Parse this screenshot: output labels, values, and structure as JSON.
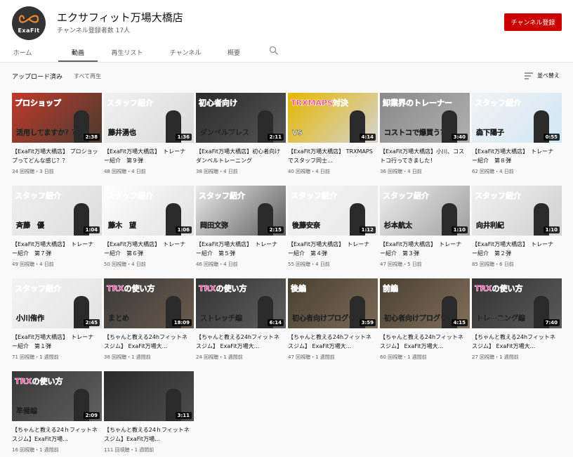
{
  "channel": {
    "name": "エクサフィット万場大橋店",
    "subscribers": "チャンネル登録者数 17人",
    "avatar_text": "ExaFit",
    "subscribe_label": "チャンネル登録"
  },
  "tabs": [
    {
      "label": "ホーム",
      "active": false
    },
    {
      "label": "動画",
      "active": true
    },
    {
      "label": "再生リスト",
      "active": false
    },
    {
      "label": "チャンネル",
      "active": false
    },
    {
      "label": "概要",
      "active": false
    }
  ],
  "search_icon": "search-icon",
  "filter": {
    "label": "アップロード済み",
    "all_label": "すべて再生"
  },
  "sort": {
    "label": "並べ替え",
    "icon": "sort-icon"
  },
  "colors": {
    "accent": "#cc0000",
    "thumb_pink": "#ff2d96"
  },
  "videos": [
    {
      "title": "【ExaFit万場大橋店】 プロショップってどんな感じ？？",
      "meta": "34 回視聴・3 日前",
      "duration": "2:38",
      "thumb_title": "プロショップ",
      "thumb_sub": "活用してますか？？",
      "palette": [
        "#c0392b",
        "#4a3b2f"
      ]
    },
    {
      "title": "【ExaFit万場大橋店】　トレーナー紹介　第９弾",
      "meta": "48 回視聴・4 日前",
      "duration": "1:36",
      "thumb_title": "スタッフ紹介",
      "thumb_sub": "藤井湧也",
      "palette": [
        "#f2f2f2",
        "#d9d9d9"
      ]
    },
    {
      "title": "【ExaFit万場大橋店】初心者向けダンベルトレーニング",
      "meta": "38 回視聴・4 日前",
      "duration": "2:11",
      "thumb_title": "初心者向け",
      "thumb_sub": "ダンベルプレス",
      "palette": [
        "#2b2b2b",
        "#555555"
      ]
    },
    {
      "title": "【ExaFit万場大橋店】 TRXMAPSでスタッフ同士...",
      "meta": "40 回視聴・4 日前",
      "duration": "4:14",
      "thumb_title": "TRXMAPS対決",
      "thumb_sub": "VS",
      "palette": [
        "#e6b800",
        "#d4d4d4"
      ]
    },
    {
      "title": "【ExaFit万場大橋店】小川、コストコ行ってきました！",
      "meta": "36 回視聴・4 日前",
      "duration": "3:40",
      "thumb_title": "卸業界のトレーナー",
      "thumb_sub": "コストコで爆買う？",
      "palette": [
        "#8a8a8a",
        "#b0b0b0"
      ]
    },
    {
      "title": "【ExaFit万場大橋店】　トレーナー紹介　第８弾",
      "meta": "62 回視聴・4 日前",
      "duration": "0:55",
      "thumb_title": "スタッフ紹介",
      "thumb_sub": "森下陽子",
      "palette": [
        "#f3f3f3",
        "#cfe6f5"
      ]
    },
    {
      "title": "【ExaFit万場大橋店】　トレーナー紹介　第７弾",
      "meta": "49 回視聴・4 日前",
      "duration": "1:04",
      "thumb_title": "スタッフ紹介",
      "thumb_sub": "斉藤　優",
      "palette": [
        "#f0f0f0",
        "#dcdcdc"
      ]
    },
    {
      "title": "【ExaFit万場大橋店】　トレーナー紹介　第６弾",
      "meta": "50 回視聴・4 日前",
      "duration": "1:06",
      "thumb_title": "スタッフ紹介",
      "thumb_sub": "藤木　望",
      "palette": [
        "#ffffff",
        "#e0e0e0"
      ]
    },
    {
      "title": "【ExaFit万場大橋店】　トレーナー紹介　第５弾",
      "meta": "46 回視聴・4 日前",
      "duration": "2:15",
      "thumb_title": "スタッフ紹介",
      "thumb_sub": "岡田文弥",
      "palette": [
        "#ececec",
        "#5c5c5c"
      ]
    },
    {
      "title": "【ExaFit万場大橋店】　トレーナー紹介　第４弾",
      "meta": "55 回視聴・4 日前",
      "duration": "1:12",
      "thumb_title": "スタッフ紹介",
      "thumb_sub": "後藤安奈",
      "palette": [
        "#f5f5f5",
        "#e8e8e8"
      ]
    },
    {
      "title": "【ExaFit万場大橋店】　トレーナー紹介　第３弾",
      "meta": "47 回視聴・5 日前",
      "duration": "1:10",
      "thumb_title": "スタッフ紹介",
      "thumb_sub": "杉本航太",
      "palette": [
        "#f0f0f0",
        "#9e9e9e"
      ]
    },
    {
      "title": "【ExaFit万場大橋店】　トレーナー紹介　第２弾",
      "meta": "85 回視聴・6 日前",
      "duration": "1:10",
      "thumb_title": "スタッフ紹介",
      "thumb_sub": "向井利紀",
      "palette": [
        "#f2f2f2",
        "#d0d0d0"
      ]
    },
    {
      "title": "【ExaFit万場大橋店】　トレーナー紹介　第１弾",
      "meta": "71 回視聴・1 週間前",
      "duration": "2:45",
      "thumb_title": "スタッフ紹介",
      "thumb_sub": "小川侑作",
      "palette": [
        "#f4f4f4",
        "#e2e2e2"
      ]
    },
    {
      "title": "【ちゃんと教える24hフィットネスジム】 ExaFit万場大...",
      "meta": "38 回視聴・1 週間前",
      "duration": "18:09",
      "thumb_title": "TRXの使い方",
      "thumb_sub": "まとめ",
      "palette": [
        "#3a3a3a",
        "#6b5b4b"
      ]
    },
    {
      "title": "【ちゃんと教える24hフィットネスジム】 ExaFit万場大...",
      "meta": "24 回視聴・1 週間前",
      "duration": "6:14",
      "thumb_title": "TRXの使い方",
      "thumb_sub": "ストレッチ編",
      "palette": [
        "#343434",
        "#5e5e5e"
      ]
    },
    {
      "title": "【ちゃんと教える24hフィットネスジム】 ExaFit万場大...",
      "meta": "47 回視聴・1 週間前",
      "duration": "3:59",
      "thumb_title": "後編",
      "thumb_sub": "初心者向けプログラム",
      "palette": [
        "#4a4030",
        "#7a6a55"
      ]
    },
    {
      "title": "【ちゃんと教える24hフィットネスジム】 ExaFit万場大...",
      "meta": "60 回視聴・1 週間前",
      "duration": "4:15",
      "thumb_title": "前編",
      "thumb_sub": "初心者向けプログラム",
      "palette": [
        "#4a4030",
        "#806f5a"
      ]
    },
    {
      "title": "【ちゃんと教える24hフィットネスジム】 ExaFit万場大...",
      "meta": "27 回視聴・1 週間前",
      "duration": "7:40",
      "thumb_title": "TRXの使い方",
      "thumb_sub": "トレーニング編",
      "palette": [
        "#333333",
        "#5a5a5a"
      ]
    },
    {
      "title": "【ちゃんと教える24ｈフィットネスジム】ExaFit万場...",
      "meta": "16 回視聴・1 週間前",
      "duration": "2:09",
      "thumb_title": "TRXの使い方",
      "thumb_sub": "準備編",
      "palette": [
        "#383838",
        "#606060"
      ]
    },
    {
      "title": "【ちゃんと教える24ｈフィットネスジム】ExaFit万場...",
      "meta": "111 回視聴・1 週間前",
      "duration": "3:11",
      "thumb_title": "",
      "thumb_sub": "",
      "palette": [
        "#2a2a2a",
        "#4d4d4d"
      ]
    }
  ]
}
